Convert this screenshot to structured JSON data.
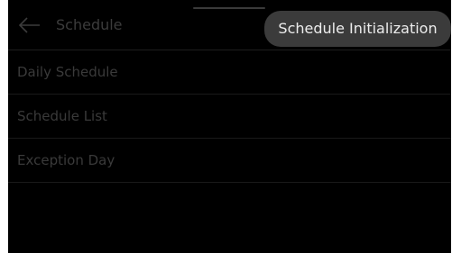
{
  "header": {
    "title": "Schedule",
    "back_icon": "arrow-left-icon"
  },
  "popup": {
    "label": "Schedule Initialization"
  },
  "menu": {
    "items": [
      {
        "label": "Daily Schedule"
      },
      {
        "label": "Schedule List"
      },
      {
        "label": "Exception Day"
      }
    ]
  },
  "colors": {
    "background": "#000000",
    "dimmed_text": "#3a3a3a",
    "popup_background": "#3b3b3b",
    "popup_text": "#ececec"
  }
}
